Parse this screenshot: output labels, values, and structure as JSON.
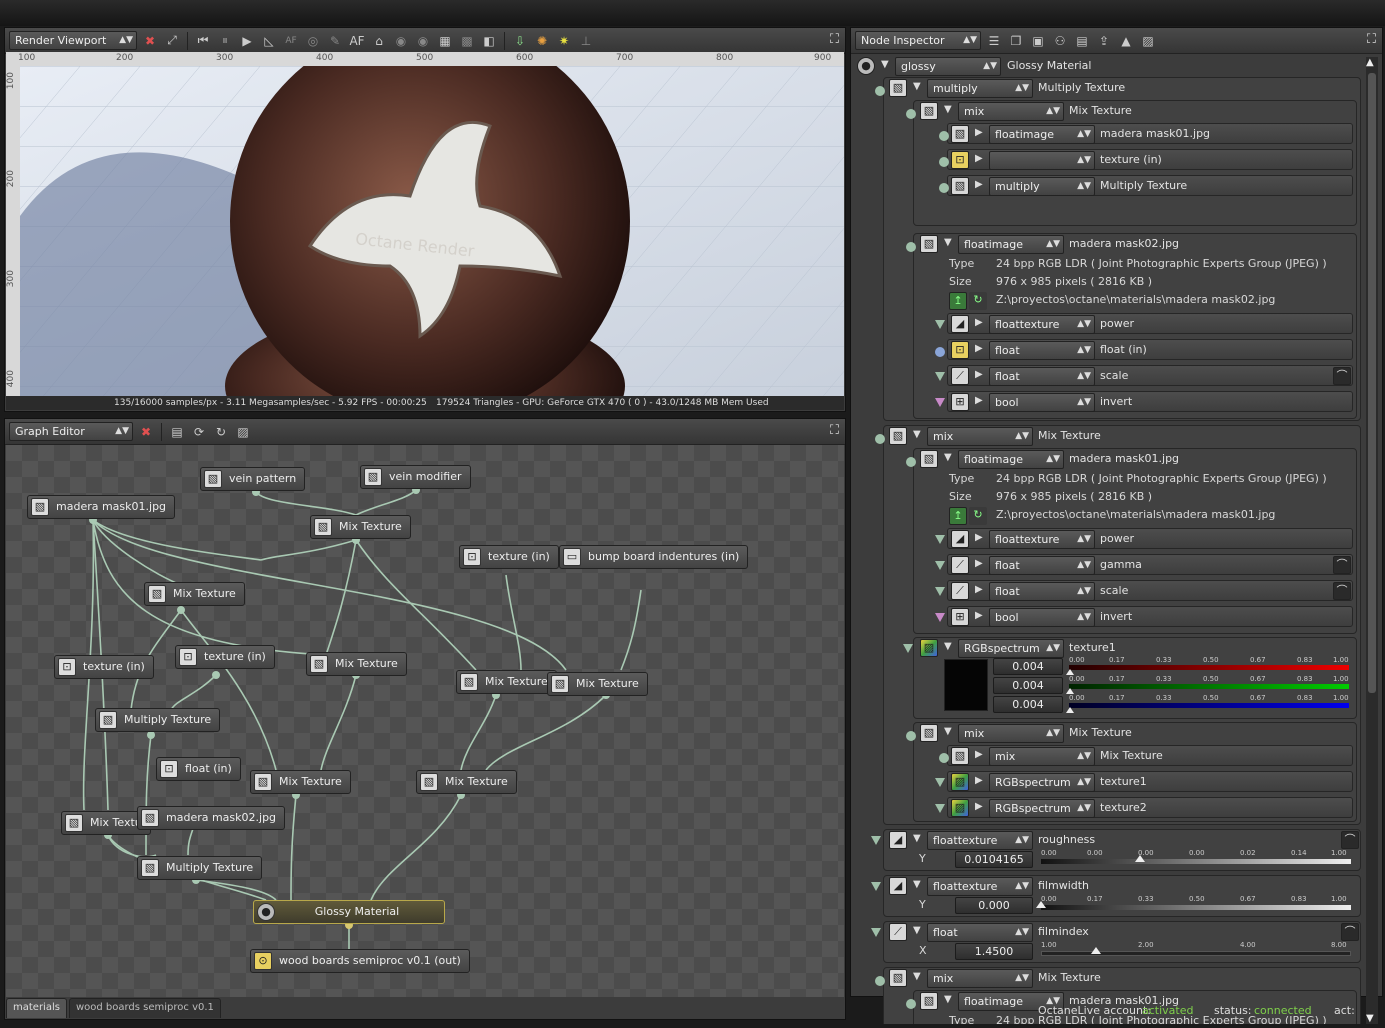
{
  "render_viewport": {
    "dropdown": "Render Viewport",
    "toolbar_icons": [
      "clear-icon",
      "fit-icon",
      "restart-icon",
      "pause-icon",
      "play-icon",
      "ruler-icon",
      "af-off-icon",
      "focus-icon",
      "pick-icon",
      "af-icon",
      "material-pick-icon",
      "region-icon",
      "film-icon",
      "grid-icon",
      "checker-icon",
      "gamma-icon",
      "save-icon",
      "color-icon",
      "gpu-icon",
      "lock-icon"
    ],
    "af_label": "AF",
    "ruler_ticks": [
      "100",
      "200",
      "300",
      "400",
      "500",
      "600",
      "700",
      "800",
      "900"
    ],
    "ruler_v_ticks": [
      "100",
      "200",
      "300",
      "400"
    ],
    "watermark": "Octane Render",
    "status_left": "135/16000 samples/px - 3.11 Megasamples/sec - 5.92 FPS - 00:00:25",
    "status_right": "179524 Triangles - GPU: GeForce GTX 470 ( 0 ) - 43.0/1248 MB Mem Used"
  },
  "graph_editor": {
    "dropdown": "Graph Editor",
    "nodes": [
      {
        "label": "vein pattern"
      },
      {
        "label": "vein modifier"
      },
      {
        "label": "madera mask01.jpg"
      },
      {
        "label": "Mix Texture"
      },
      {
        "label": "texture (in)"
      },
      {
        "label": "bump board indentures (in)"
      },
      {
        "label": "Mix Texture"
      },
      {
        "label": "texture (in)"
      },
      {
        "label": "texture (in)"
      },
      {
        "label": "Mix Texture"
      },
      {
        "label": "Mix Texture"
      },
      {
        "label": "Mix Texture"
      },
      {
        "label": "Multiply Texture"
      },
      {
        "label": "float (in)"
      },
      {
        "label": "Mix Texture"
      },
      {
        "label": "Mix Texture"
      },
      {
        "label": "Mix Textu"
      },
      {
        "label": "madera mask02.jpg"
      },
      {
        "label": "Multiply Texture"
      },
      {
        "label": "Glossy Material"
      },
      {
        "label": "wood boards semiproc v0.1 (out)"
      }
    ],
    "tabs": [
      "materials",
      "wood boards semiproc v0.1"
    ]
  },
  "node_inspector": {
    "dropdown": "Node Inspector",
    "rows": {
      "r0": {
        "type": "glossy",
        "label": "Glossy Material"
      },
      "r1": {
        "type": "multiply",
        "label": "Multiply Texture"
      },
      "r2": {
        "type": "mix",
        "label": "Mix Texture"
      },
      "r3": {
        "type": "floatimage",
        "label": "madera mask01.jpg"
      },
      "r4": {
        "type": "",
        "label": "texture (in)"
      },
      "r5": {
        "type": "multiply",
        "label": "Multiply Texture"
      },
      "r6": {
        "type": "floatimage",
        "label": "madera mask02.jpg"
      },
      "r6_info": {
        "type_k": "Type",
        "type_v": "24 bpp RGB LDR ( Joint Photographic Experts Group (JPEG) )",
        "size_k": "Size",
        "size_v": "976 x 985 pixels ( 2816 KB )",
        "path": "Z:\\proyectos\\octane\\materials\\madera mask02.jpg"
      },
      "r7": {
        "type": "floattexture",
        "label": "power"
      },
      "r8": {
        "type": "float",
        "label": "float (in)"
      },
      "r9": {
        "type": "float",
        "label": "scale"
      },
      "r10": {
        "type": "bool",
        "label": "invert"
      },
      "r11": {
        "type": "mix",
        "label": "Mix Texture"
      },
      "r12": {
        "type": "floatimage",
        "label": "madera mask01.jpg"
      },
      "r12_info": {
        "type_k": "Type",
        "type_v": "24 bpp RGB LDR ( Joint Photographic Experts Group (JPEG) )",
        "size_k": "Size",
        "size_v": "976 x 985 pixels ( 2816 KB )",
        "path": "Z:\\proyectos\\octane\\materials\\madera mask01.jpg"
      },
      "r13": {
        "type": "floattexture",
        "label": "power"
      },
      "r14": {
        "type": "float",
        "label": "gamma"
      },
      "r15": {
        "type": "float",
        "label": "scale"
      },
      "r16": {
        "type": "bool",
        "label": "invert"
      },
      "r17": {
        "type": "RGBspectrum",
        "label": "texture1",
        "values": [
          "0.004",
          "0.004",
          "0.004"
        ]
      },
      "r18": {
        "type": "mix",
        "label": "Mix Texture"
      },
      "r19": {
        "type": "mix",
        "label": "Mix Texture"
      },
      "r20": {
        "type": "RGBspectrum",
        "label": "texture1"
      },
      "r21": {
        "type": "RGBspectrum",
        "label": "texture2"
      },
      "r22": {
        "type": "floattexture",
        "label": "roughness",
        "axis": "Y",
        "value": "0.0104165",
        "value_fraction": 0.0104165
      },
      "r23": {
        "type": "floattexture",
        "label": "filmwidth",
        "axis": "Y",
        "value": "0.000",
        "value_fraction": 0.0
      },
      "r24": {
        "type": "float",
        "label": "filmindex",
        "axis": "X",
        "value": "1.4500"
      },
      "r25": {
        "type": "mix",
        "label": "Mix Texture"
      },
      "r26": {
        "type": "floatimage",
        "label": "madera mask01.jpg"
      },
      "r26_info": {
        "type_k": "Type",
        "type_v": "24 bpp RGB LDR ( Joint Photographic Experts Group (JPEG) )"
      }
    },
    "rgb_scale": [
      "0.00",
      "0.17",
      "0.33",
      "0.50",
      "0.67",
      "0.83",
      "1.00"
    ],
    "rgb_levels": [
      0.004,
      0.004,
      0.004
    ],
    "rough_scale": [
      "0.00",
      "0.00",
      "0.00",
      "0.00",
      "0.02",
      "0.14",
      "1.00"
    ],
    "film_scale": [
      "0.00",
      "0.17",
      "0.33",
      "0.50",
      "0.67",
      "0.83",
      "1.00"
    ],
    "index_scale": [
      "1.00",
      "2.00",
      "4.00",
      "8.00"
    ],
    "index_level": 1.45
  },
  "footer": {
    "account_label": "OctaneLive account:",
    "account_value": "activated",
    "status_label": "status:",
    "status_value": "connected",
    "act_label": "act:"
  },
  "colors": {
    "accent_green": "#7fd04b",
    "node_link": "#a9c9b3",
    "glossy_border": "#b8a84a"
  }
}
